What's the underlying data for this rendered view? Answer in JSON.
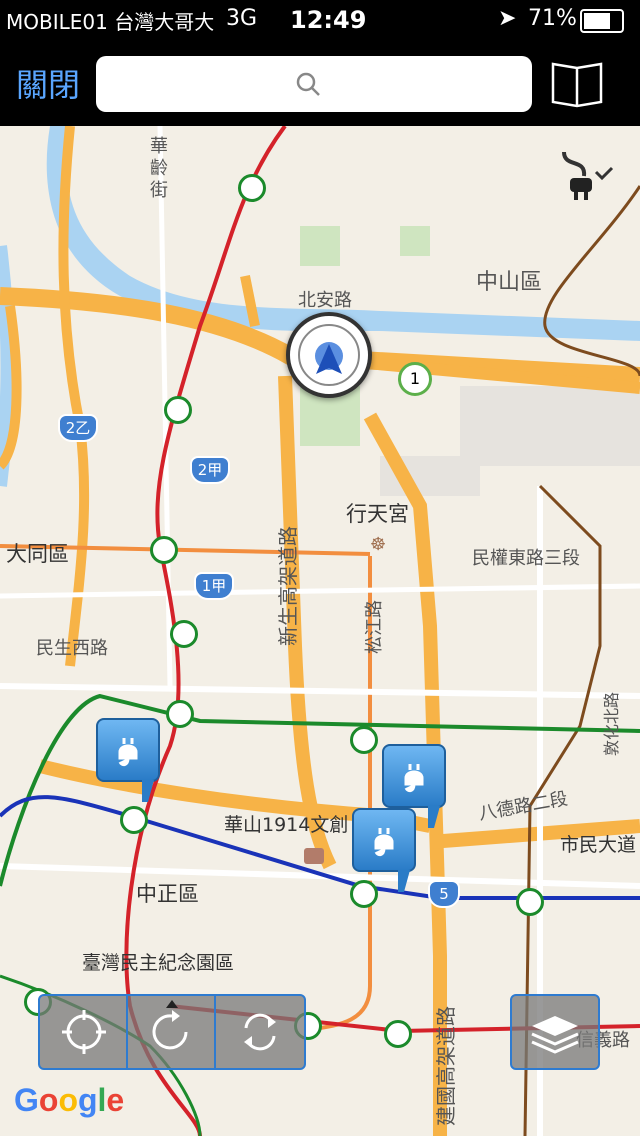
{
  "status_bar": {
    "carrier": "MOBILE01 台灣大哥大",
    "network": "3G",
    "time": "12:49",
    "battery": "71%"
  },
  "nav_bar": {
    "close_label": "關閉",
    "search_placeholder": ""
  },
  "map": {
    "labels": {
      "huanan_st": "華​齡​街",
      "zhongshan_district": "中山區",
      "beian_rd": "北安路",
      "xingtian_temple": "行天宮",
      "datong_district": "大同區",
      "minquan_e_rd": "民權東路三段",
      "xinsheng_expwy": "新生高架道路",
      "songjiang_rd": "松江路",
      "minsheng_w_rd": "民生西路",
      "dunhua_n_rd": "敦化北路",
      "bade_rd": "八德路二段",
      "huashan": "華山1914文創",
      "civic_blvd": "市民大道",
      "zhongzheng_district": "中正區",
      "cks_memorial": "臺灣民主紀念園區",
      "jianguo_expwy": "建國高架道路",
      "xinyi_rd": "信義路"
    },
    "shields": {
      "r2b": "2乙",
      "r2a": "2甲",
      "r1a": "1甲",
      "r5": "5",
      "r1": "1"
    },
    "attribution": "Google"
  },
  "controls": {
    "recenter": "recenter",
    "rotate": "rotate",
    "refresh": "refresh",
    "layers": "layers"
  }
}
